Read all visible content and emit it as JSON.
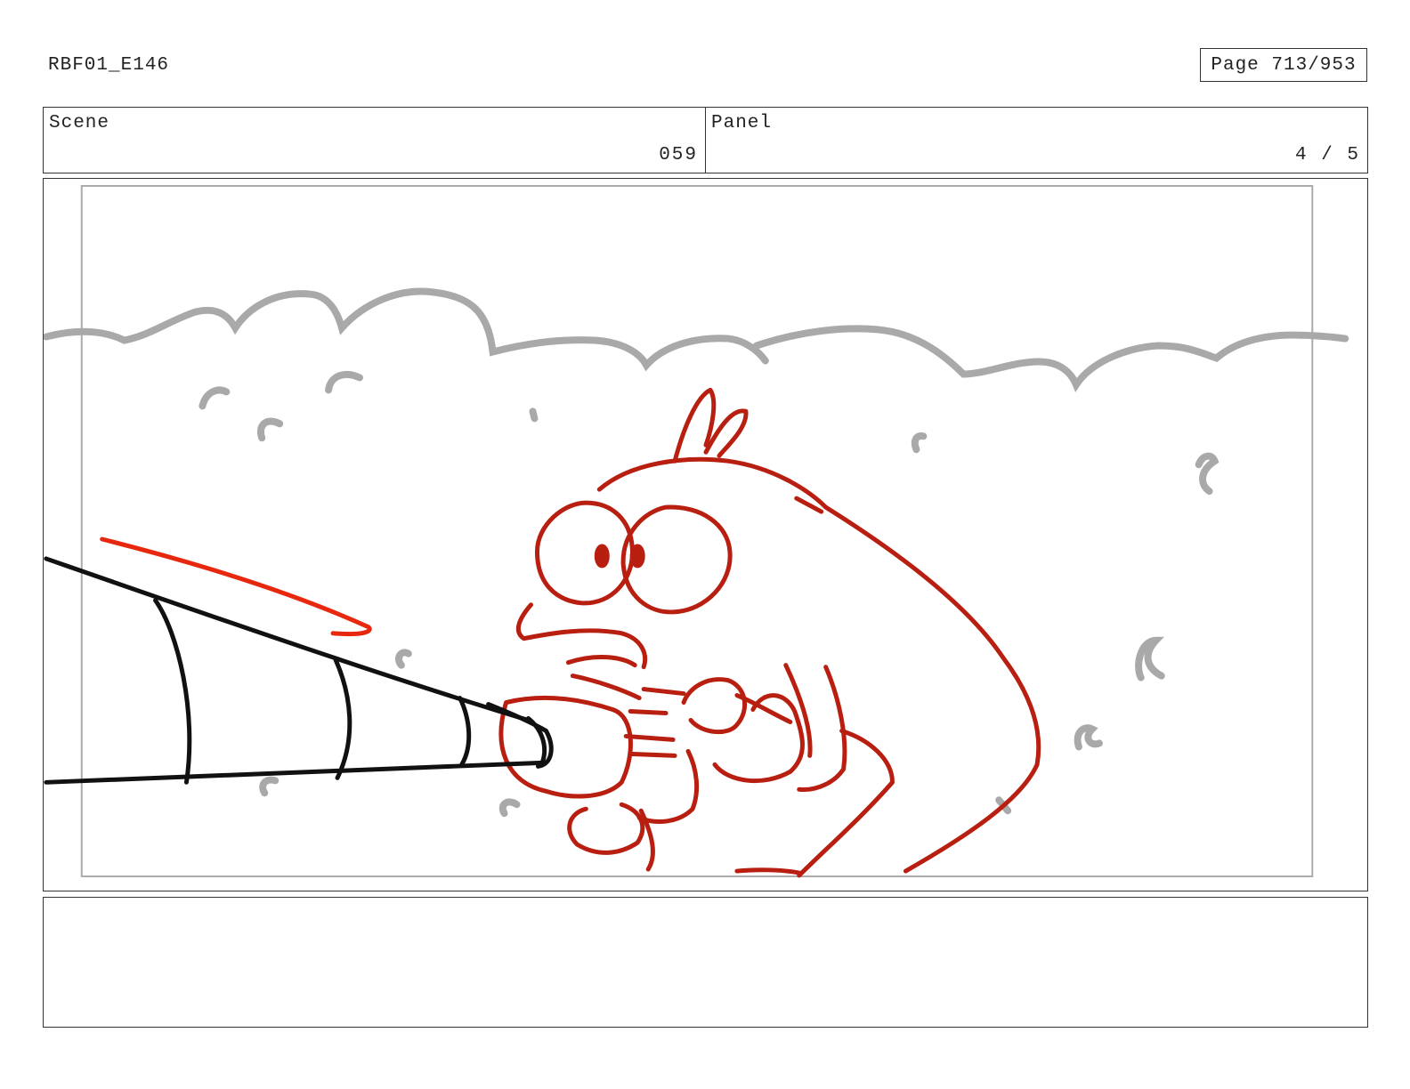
{
  "header": {
    "doc_id": "RBF01_E146",
    "page_label": "Page 713/953"
  },
  "info": {
    "scene_label": "Scene",
    "scene_value": "059",
    "panel_label": "Panel",
    "panel_value": "4 / 5"
  },
  "colors": {
    "sketch_red": "#b81f10",
    "sketch_bright_red": "#e8280e",
    "sketch_black": "#111111",
    "sketch_gray": "#a9a9a9",
    "border": "#333333"
  },
  "notes": {
    "text": ""
  }
}
